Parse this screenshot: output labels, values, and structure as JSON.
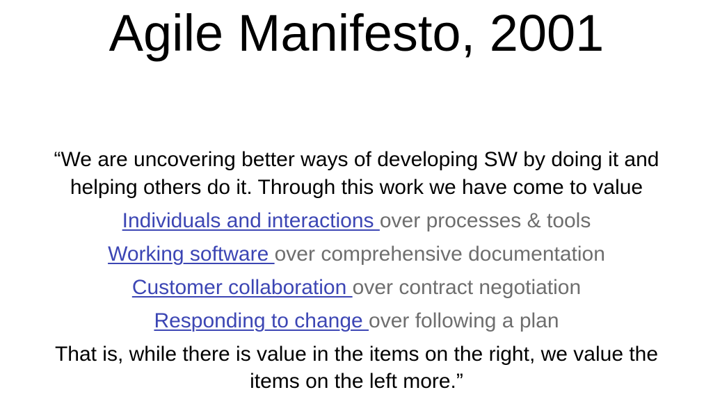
{
  "slide": {
    "title": "Agile Manifesto, 2001",
    "intro_lines": [
      "“We are uncovering better ways of developing SW by doing it and",
      "helping others do it. Through this work we have come to value"
    ],
    "values": [
      {
        "left": "Individuals and interactions ",
        "right": "over processes & tools"
      },
      {
        "left": "Working software ",
        "right": "over comprehensive documentation"
      },
      {
        "left": "Customer collaboration ",
        "right": "over contract negotiation"
      },
      {
        "left": "Responding to change ",
        "right": "over following a plan"
      }
    ],
    "closing_lines": [
      "That is, while there is value in the items on the right, we value the",
      "items on the left more.”"
    ],
    "colors": {
      "link": "#3c46b4",
      "secondary": "#6e6e6e",
      "text": "#000000"
    }
  }
}
